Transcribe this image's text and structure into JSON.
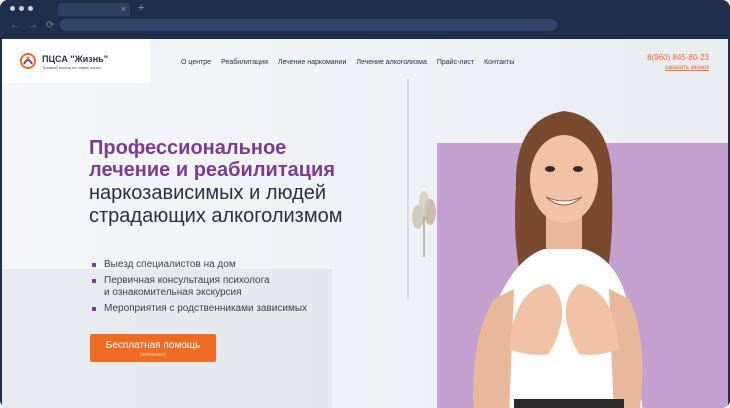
{
  "browser": {
    "tab_close": "×",
    "new_tab": "+",
    "nav": {
      "back": "←",
      "forward": "→",
      "reload": "⟳"
    }
  },
  "site": {
    "logo": {
      "name": "ПЦСА \"Жизнь\"",
      "tagline": "Трезвый взгляд на новую жизнь"
    },
    "menu": [
      "О центре",
      "Реабилитация",
      "Лечение наркомании",
      "Лечение алкоголизма",
      "Прайс-лист",
      "Контакты"
    ],
    "phone": "8(960) 845-80-23",
    "callback": "заказать звонок"
  },
  "hero": {
    "title_line1": "Профессиональное",
    "title_line2": "лечение и реабилитация",
    "subtitle_line1": "наркозависимых и людей",
    "subtitle_line2": "страдающих алкоголизмом",
    "bullets": [
      "Выезд специалистов на дом",
      "Первичная консультация психолога",
      "и ознакомительная экскурсия",
      "Мероприятия с родственниками зависимых"
    ],
    "cta_label": "Бесплатная помощь",
    "cta_sub": "(анонимно)"
  },
  "colors": {
    "brand_purple": "#7a3d94",
    "accent_orange": "#f06b23",
    "purple_block": "#c3a0cf",
    "browser_chrome": "#1f2e4b"
  }
}
